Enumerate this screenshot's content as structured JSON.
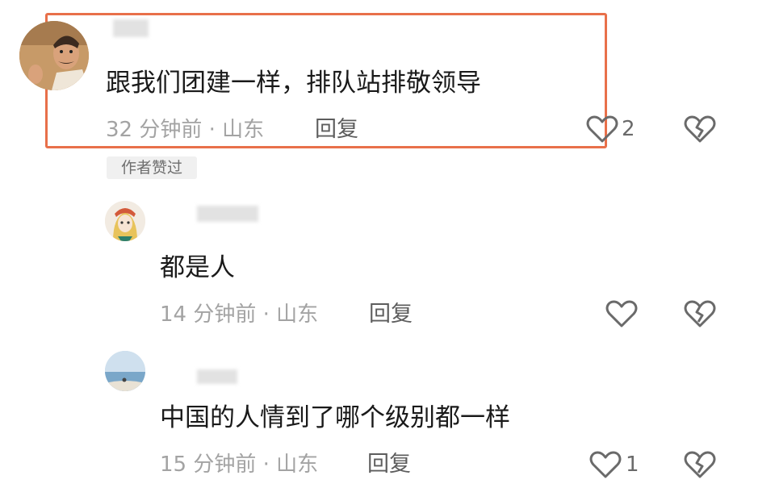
{
  "comments": [
    {
      "avatar": "cartoon-man-avatar",
      "text": "跟我们团建一样，排队站排敬领导",
      "time": "32 分钟前 · 山东",
      "reply_label": "回复",
      "like_count": "2",
      "badge": "作者赞过",
      "highlighted": true
    },
    {
      "avatar": "anime-girl-avatar",
      "text": "都是人",
      "time": "14 分钟前 · 山东",
      "reply_label": "回复",
      "like_count": ""
    },
    {
      "avatar": "seascape-avatar",
      "text": "中国的人情到了哪个级别都一样",
      "time": "15 分钟前 · 山东",
      "reply_label": "回复",
      "like_count": "1"
    }
  ],
  "colors": {
    "highlight_border": "#e8704a",
    "text": "#1a1a1a",
    "meta": "#a3a3a3"
  },
  "icons": {
    "like": "heart-outline-icon",
    "dislike": "broken-heart-icon"
  }
}
